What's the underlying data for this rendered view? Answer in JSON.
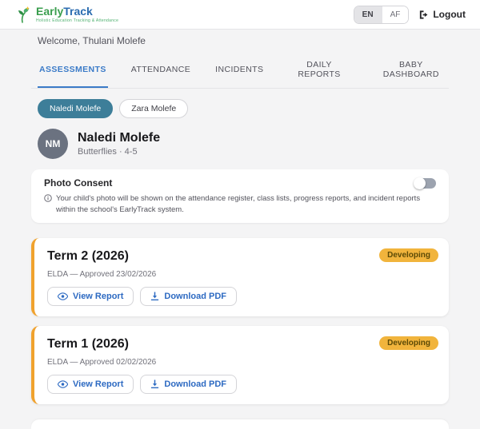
{
  "header": {
    "brand": {
      "name_green": "Early",
      "name_blue": "Track",
      "tagline": "Holistic Education Tracking & Attendance"
    },
    "language": {
      "options": [
        "EN",
        "AF"
      ],
      "selected": "EN"
    },
    "logout_label": "Logout"
  },
  "welcome": "Welcome, Thulani Molefe",
  "tabs": [
    {
      "label": "ASSESSMENTS",
      "active": true
    },
    {
      "label": "ATTENDANCE",
      "active": false
    },
    {
      "label": "INCIDENTS",
      "active": false
    },
    {
      "label": "DAILY REPORTS",
      "active": false
    },
    {
      "label": "BABY DASHBOARD",
      "active": false
    }
  ],
  "children_chips": [
    {
      "label": "Naledi Molefe",
      "active": true
    },
    {
      "label": "Zara Molefe",
      "active": false
    }
  ],
  "profile": {
    "initials": "NM",
    "name": "Naledi Molefe",
    "group": "Butterflies · 4-5"
  },
  "photo_consent": {
    "title": "Photo Consent",
    "toggle_state": "off",
    "info": "Your child's photo will be shown on the attendance register, class lists, progress reports, and incident reports within the school's EarlyTrack system."
  },
  "reports": [
    {
      "title": "Term 2 (2026)",
      "status": "Developing",
      "meta": "ELDA — Approved 23/02/2026",
      "view_label": "View Report",
      "download_label": "Download PDF"
    },
    {
      "title": "Term 1 (2026)",
      "status": "Developing",
      "meta": "ELDA — Approved 02/02/2026",
      "view_label": "View Report",
      "download_label": "Download PDF"
    }
  ],
  "colors": {
    "accent-blue": "#3b7bc8",
    "chip-teal": "#3d7e99",
    "badge-amber": "#f1b43c",
    "card-edge-orange": "#f0a22e",
    "btn-blue": "#2d6ac2",
    "bg": "#f4f4f5"
  }
}
